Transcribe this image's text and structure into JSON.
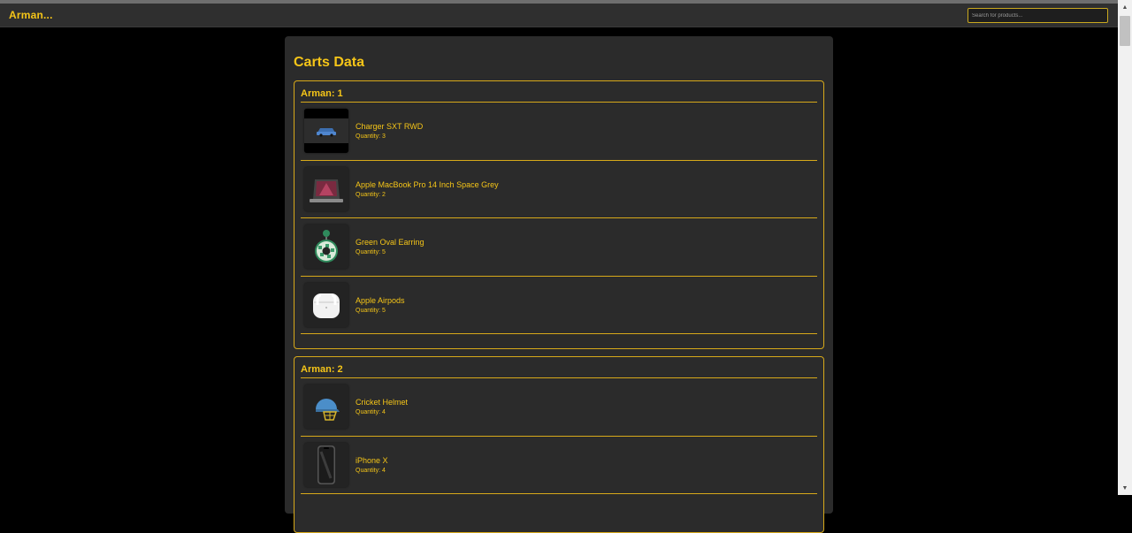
{
  "navbar": {
    "brand": "Arman...",
    "search_placeholder": "Search for products..."
  },
  "page": {
    "title": "Carts Data"
  },
  "carts": [
    {
      "title": "Arman: 1",
      "items": [
        {
          "name": "Charger SXT RWD",
          "quantity": "Quantity: 3",
          "icon": "car-image"
        },
        {
          "name": "Apple MacBook Pro 14 Inch Space Grey",
          "quantity": "Quantity: 2",
          "icon": "laptop-image"
        },
        {
          "name": "Green Oval Earring",
          "quantity": "Quantity: 5",
          "icon": "earring-image"
        },
        {
          "name": "Apple Airpods",
          "quantity": "Quantity: 5",
          "icon": "airpods-image"
        }
      ]
    },
    {
      "title": "Arman: 2",
      "items": [
        {
          "name": "Cricket Helmet",
          "quantity": "Quantity: 4",
          "icon": "helmet-image"
        },
        {
          "name": "iPhone X",
          "quantity": "Quantity: 4",
          "icon": "phone-image"
        }
      ]
    }
  ],
  "colors": {
    "accent": "#f5c518",
    "border": "#d7a91a",
    "panel": "#2b2b2b",
    "background": "#000000"
  }
}
